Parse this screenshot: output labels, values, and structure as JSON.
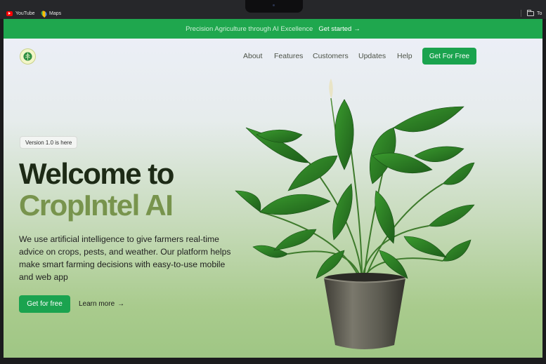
{
  "bookmarks": {
    "youtube": "YouTube",
    "maps": "Maps",
    "right_folder": "To"
  },
  "banner": {
    "text": "Precision Agriculture through AI Excellence",
    "link": "Get started"
  },
  "nav": {
    "items": [
      "About",
      "Features",
      "Customers",
      "Updates",
      "Help"
    ],
    "cta": "Get For Free"
  },
  "hero": {
    "badge": "Version 1.0 is here",
    "title_line1": "Welcome to",
    "title_line2": "CropIntel AI",
    "description": "We use artificial intelligence to give farmers real-time advice on crops, pests, and weather. Our platform helps make smart farming decisions with easy-to-use mobile and web app",
    "primary_button": "Get for free",
    "secondary_link": "Learn more"
  },
  "colors": {
    "brand_green": "#1fa74e",
    "title_dark": "#1d2a16",
    "title_accent": "#78944d"
  }
}
